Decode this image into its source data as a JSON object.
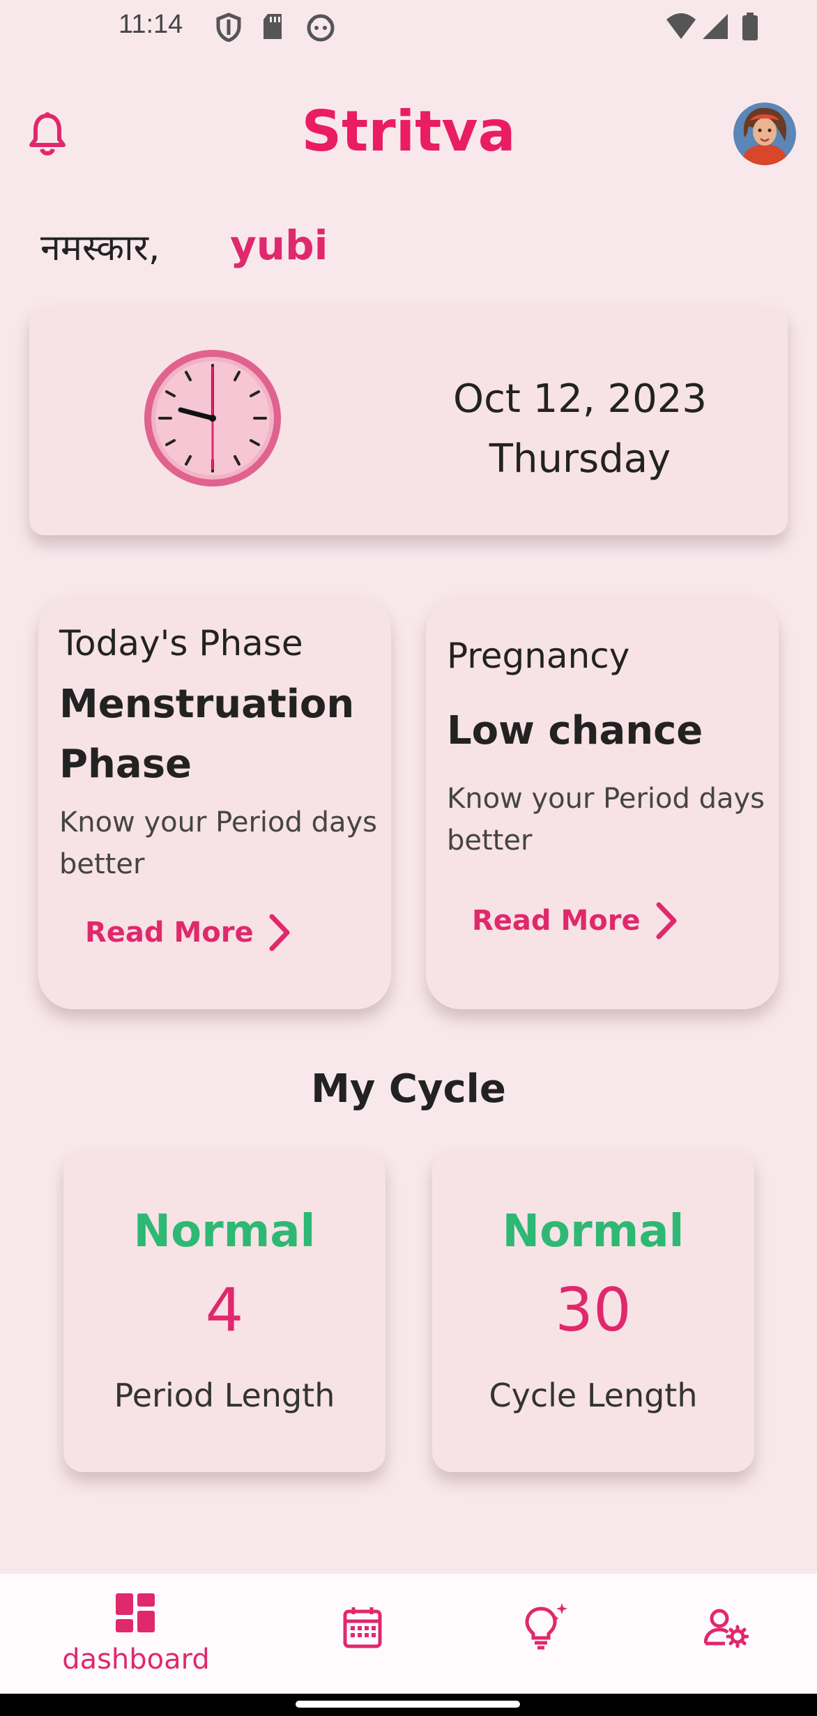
{
  "status_bar": {
    "time": "11:14",
    "left_icons": [
      "shield-icon",
      "sd-card-icon",
      "face-icon"
    ],
    "right_icons": [
      "wifi-icon",
      "signal-icon",
      "battery-icon"
    ]
  },
  "header": {
    "title": "Stritva",
    "bell_icon": "bell-icon",
    "avatar": "avatar"
  },
  "greeting": {
    "salutation": "नमस्कार,",
    "name": "yubi"
  },
  "date_card": {
    "clock_icon": "clock-icon",
    "date": "Oct 12, 2023",
    "weekday": "Thursday"
  },
  "phase_card": {
    "label": "Today's Phase",
    "value": "Menstruation Phase",
    "description": "Know your Period days better",
    "link": "Read More"
  },
  "pregnancy_card": {
    "label": "Pregnancy",
    "value": "Low chance",
    "description": "Know your Period days better",
    "link": "Read More"
  },
  "my_cycle": {
    "title": "My Cycle",
    "stats": [
      {
        "status": "Normal",
        "value": "4",
        "label": "Period Length"
      },
      {
        "status": "Normal",
        "value": "30",
        "label": "Cycle Length"
      }
    ]
  },
  "bottom_nav": {
    "items": [
      {
        "icon": "dashboard-icon",
        "label": "dashboard",
        "active": true
      },
      {
        "icon": "calendar-icon",
        "label": "",
        "active": false
      },
      {
        "icon": "lightbulb-icon",
        "label": "",
        "active": false
      },
      {
        "icon": "user-settings-icon",
        "label": "",
        "active": false
      }
    ]
  },
  "colors": {
    "background": "#f8e8ec",
    "accent": "#ea1c64",
    "card": "#f7e2e6",
    "normal_status": "#2db874"
  }
}
